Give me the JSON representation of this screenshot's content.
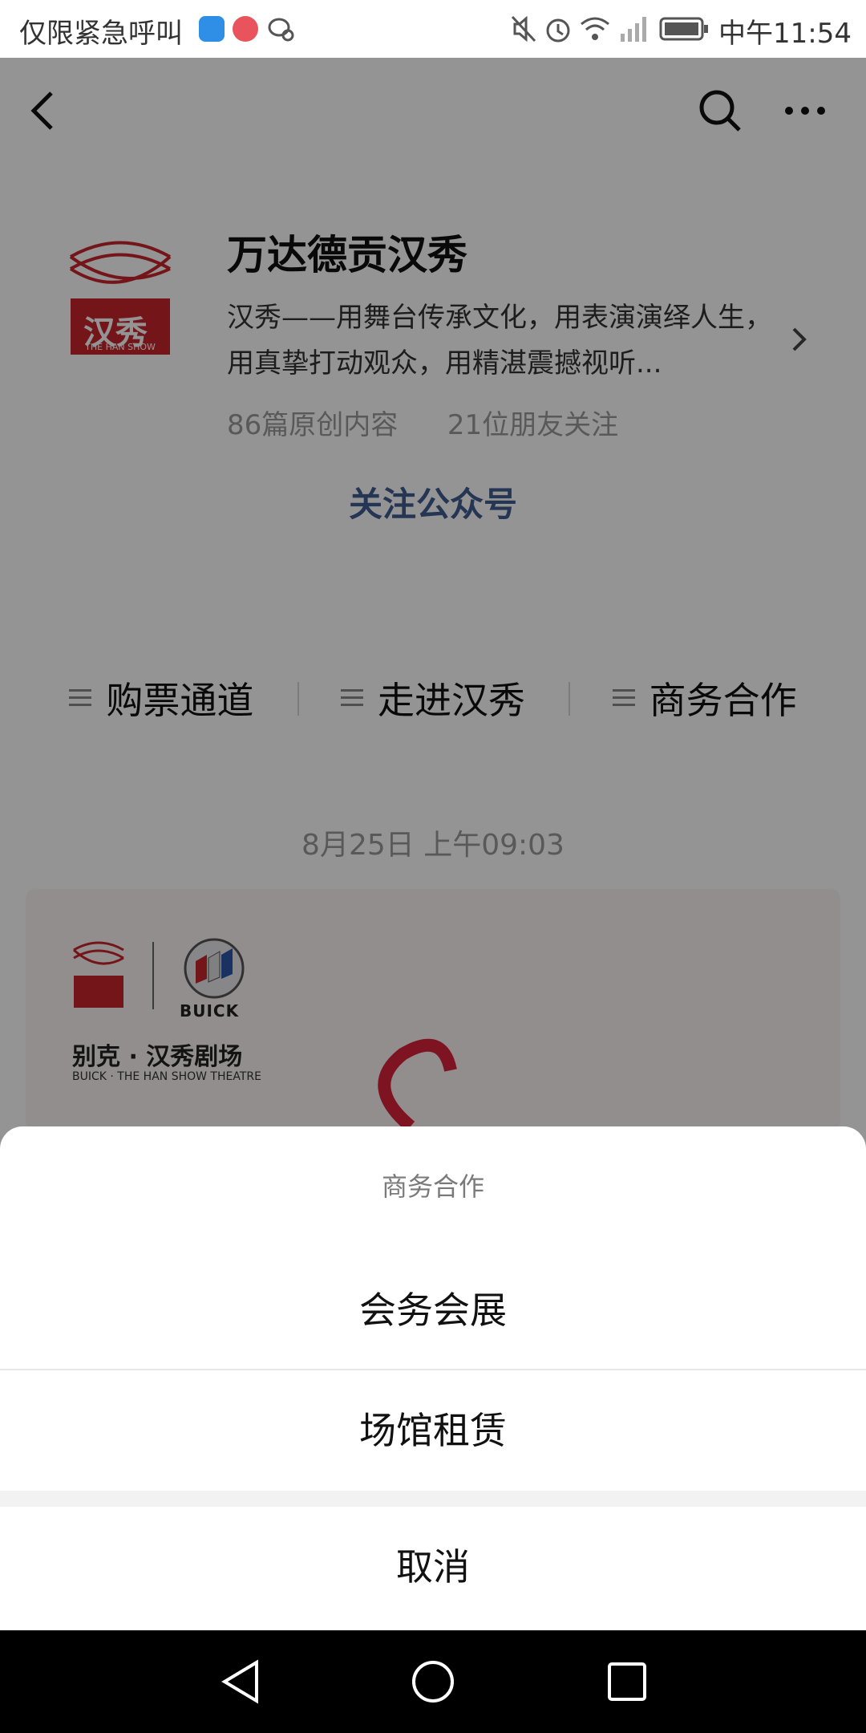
{
  "status_bar": {
    "left_text": "仅限紧急呼叫",
    "time": "中午11:54",
    "icons": [
      "shield-icon",
      "app-icon",
      "wechat-icon",
      "mute-icon",
      "alarm-icon",
      "wifi-icon",
      "signal-icon",
      "battery-icon"
    ]
  },
  "nav": {
    "icons": [
      "back-arrow-icon",
      "search-icon",
      "more-icon"
    ]
  },
  "account": {
    "name": "万达德贡汉秀",
    "description": "汉秀——用舞台传承文化，用表演演绎人生，用真挚打动观众，用精湛震撼视听...",
    "original_count": "86篇原创内容",
    "friends_following": "21位朋友关注",
    "follow_label": "关注公众号",
    "logo_caption": "THE HAN SHOW",
    "logo_text": "汉秀"
  },
  "menu": {
    "items": [
      {
        "label": "购票通道"
      },
      {
        "label": "走进汉秀"
      },
      {
        "label": "商务合作"
      }
    ]
  },
  "message": {
    "time": "8月25日 上午09:03",
    "card_brand": "BUICK",
    "card_title": "别克 · 汉秀剧场",
    "card_subtitle": "BUICK · THE HAN SHOW THEATRE"
  },
  "action_sheet": {
    "title": "商务合作",
    "options": [
      "会务会展",
      "场馆租赁"
    ],
    "cancel_label": "取消"
  },
  "colors": {
    "brand_red": "#c8262c",
    "link_blue": "#3e5d8f",
    "overlay": "rgba(0,0,0,0.42)"
  }
}
